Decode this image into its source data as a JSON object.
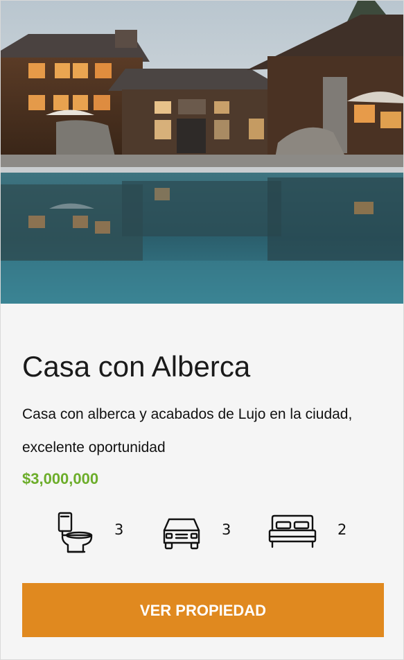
{
  "property": {
    "title": "Casa con Alberca",
    "description": "Casa con alberca y acabados de Lujo en la ciudad, excelente oportunidad",
    "price": "$3,000,000",
    "features": {
      "bathrooms": "3",
      "parking": "3",
      "bedrooms": "2"
    },
    "button_label": "VER PROPIEDAD"
  },
  "colors": {
    "price": "#6cad2a",
    "button": "#e0891f",
    "card_background": "#f5f5f5"
  },
  "icons": [
    "toilet-icon",
    "car-icon",
    "bed-icon"
  ]
}
